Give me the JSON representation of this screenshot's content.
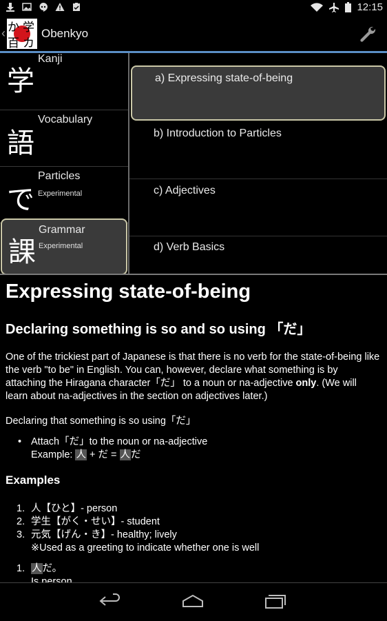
{
  "status": {
    "time": "12:15"
  },
  "app": {
    "title": "Obenkyo"
  },
  "sidebar": {
    "items": [
      {
        "kanji": "学",
        "label": "Kanji",
        "sub": ""
      },
      {
        "kanji": "語",
        "label": "Vocabulary",
        "sub": ""
      },
      {
        "kanji": "で",
        "label": "Particles",
        "sub": "Experimental"
      },
      {
        "kanji": "課",
        "label": "Grammar",
        "sub": "Experimental"
      }
    ]
  },
  "lessons": {
    "items": [
      {
        "label": "a) Expressing state-of-being"
      },
      {
        "label": "b) Introduction to Particles"
      },
      {
        "label": "c) Adjectives"
      },
      {
        "label": "d) Verb Basics"
      }
    ]
  },
  "content": {
    "title": "Expressing state-of-being",
    "subtitle": "Declaring something is so and so using 「だ」",
    "para1_a": "One of the trickiest part of Japanese is that there is no verb for the state-of-being like the verb \"to be\" in English. You can, however, declare what something is by attaching the Hiragana character「だ」 to a noun or na-adjective ",
    "para1_bold": "only",
    "para1_b": ". (We will learn about na-adjectives in the section on adjectives later.)",
    "para2": "Declaring that something is so using「だ」",
    "bullet_line1": "Attach「だ」to the noun or na-adjective",
    "bullet_example_label": "Example: ",
    "bullet_ex_word1": "人",
    "bullet_ex_mid": " + だ = ",
    "bullet_ex_word2": "人",
    "bullet_ex_end": "だ",
    "examples_heading": "Examples",
    "examples": [
      {
        "num": "1.",
        "text": "人【ひと】- person"
      },
      {
        "num": "2.",
        "text": "学生【がく・せい】- student"
      },
      {
        "num": "3.",
        "text": "元気【げん・き】- healthy; lively"
      },
      {
        "num": "",
        "text": "※Used as a greeting to indicate whether one is well"
      }
    ],
    "example2_num": "1.",
    "example2_word": "人",
    "example2_rest": "だ。",
    "example2_trans": "Is person."
  },
  "colors": {
    "accent": "#5b8fc6",
    "selected_border": "#cbc8a8",
    "selected_bg": "#3a3a3a"
  }
}
